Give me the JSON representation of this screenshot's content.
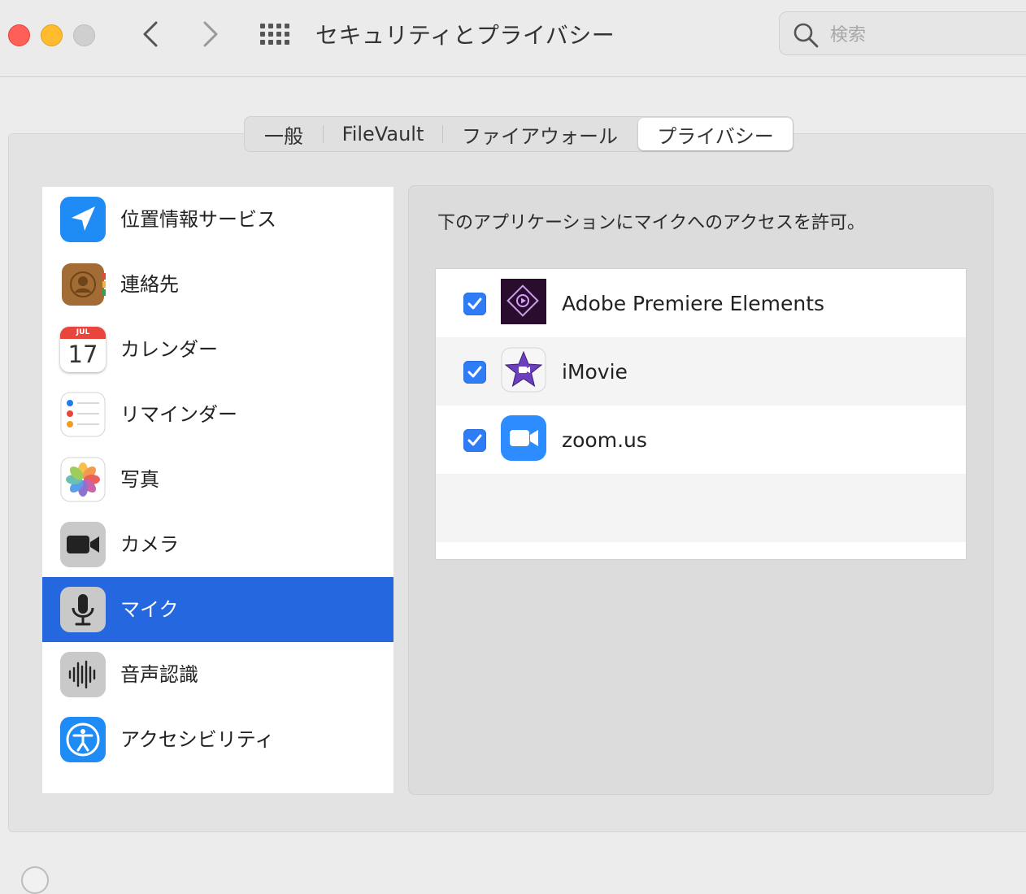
{
  "window": {
    "title": "セキュリティとプライバシー",
    "search_placeholder": "検索"
  },
  "tabs": [
    {
      "label": "一般",
      "selected": false
    },
    {
      "label": "FileVault",
      "selected": false
    },
    {
      "label": "ファイアウォール",
      "selected": false
    },
    {
      "label": "プライバシー",
      "selected": true
    }
  ],
  "sidebar": {
    "items": [
      {
        "label": "位置情報サービス",
        "icon": "location-arrow-icon",
        "selected": false
      },
      {
        "label": "連絡先",
        "icon": "contacts-book-icon",
        "selected": false
      },
      {
        "label": "カレンダー",
        "icon": "calendar-icon",
        "selected": false,
        "calendar_month": "JUL",
        "calendar_day": "17"
      },
      {
        "label": "リマインダー",
        "icon": "reminders-icon",
        "selected": false
      },
      {
        "label": "写真",
        "icon": "photos-flower-icon",
        "selected": false
      },
      {
        "label": "カメラ",
        "icon": "camera-icon",
        "selected": false
      },
      {
        "label": "マイク",
        "icon": "microphone-icon",
        "selected": true
      },
      {
        "label": "音声認識",
        "icon": "speech-waveform-icon",
        "selected": false
      },
      {
        "label": "アクセシビリティ",
        "icon": "accessibility-icon",
        "selected": false
      }
    ]
  },
  "panel": {
    "description": "下のアプリケーションにマイクへのアクセスを許可。",
    "apps": [
      {
        "name": "Adobe Premiere Elements",
        "icon": "premiere-elements-icon",
        "checked": true
      },
      {
        "name": "iMovie",
        "icon": "imovie-star-icon",
        "checked": true
      },
      {
        "name": "zoom.us",
        "icon": "zoom-camera-icon",
        "checked": true
      }
    ]
  },
  "colors": {
    "selection": "#2467de",
    "checkbox": "#2e7cf6",
    "close": "#fe5f57",
    "minimize": "#febc2e",
    "zoom": "#cfcfcf"
  }
}
